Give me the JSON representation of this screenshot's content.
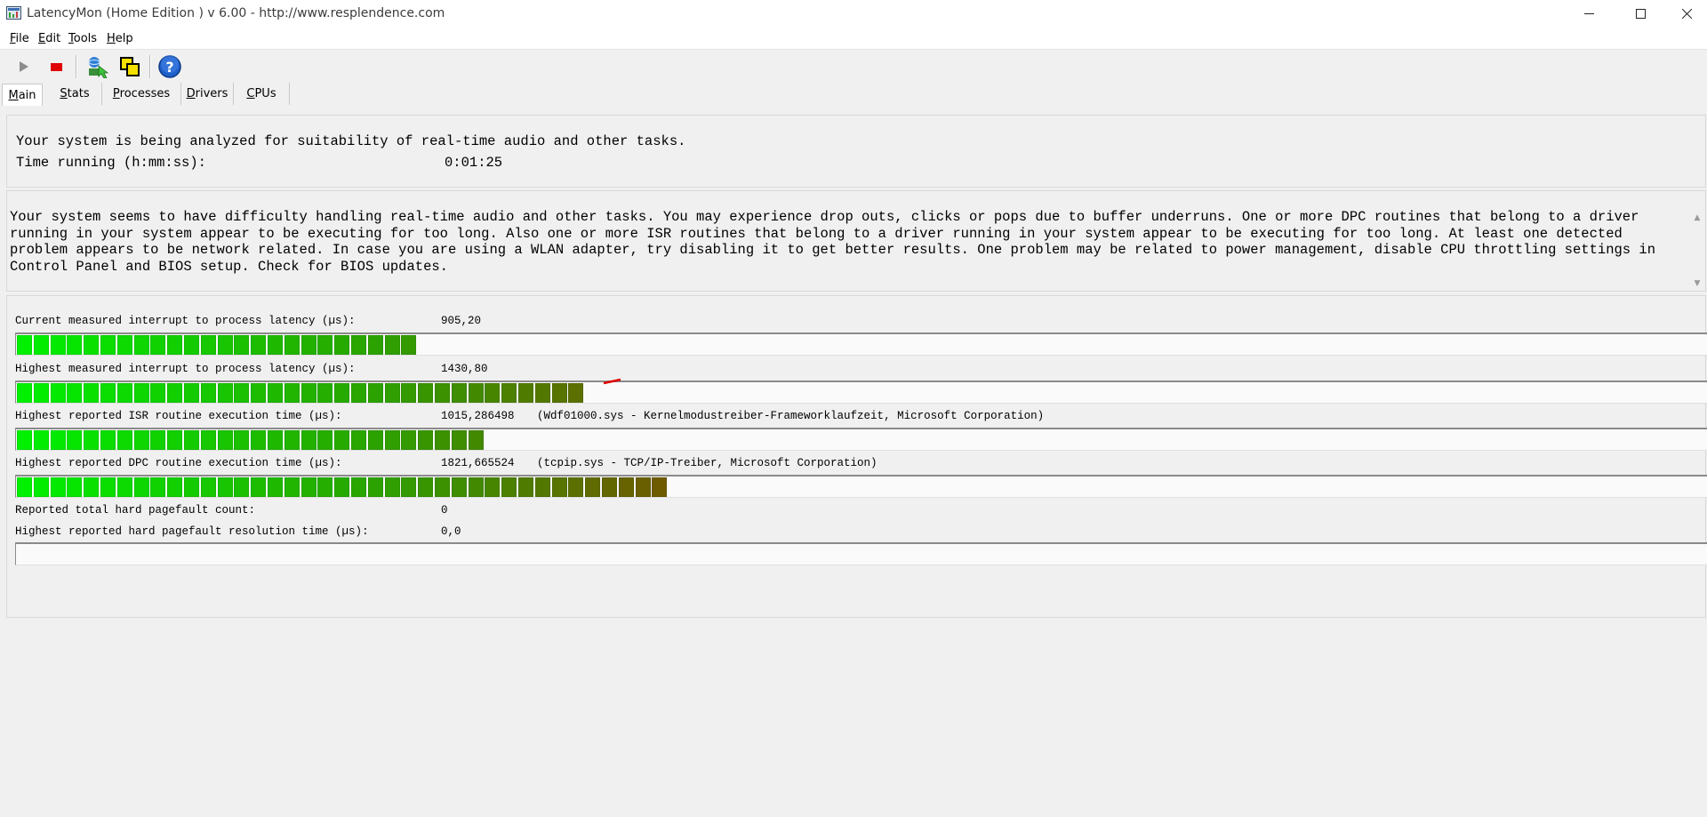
{
  "window": {
    "title": "LatencyMon  (Home Edition )  v 6.00 - http://www.resplendence.com",
    "icon": "latencymon-app-icon"
  },
  "menu": [
    {
      "label": "File",
      "accel": "F",
      "rest": "ile"
    },
    {
      "label": "Edit",
      "accel": "E",
      "rest": "dit"
    },
    {
      "label": "Tools",
      "accel": "T",
      "rest": "ools"
    },
    {
      "label": "Help",
      "accel": "H",
      "rest": "elp"
    }
  ],
  "toolbar": {
    "icons": [
      "play-icon",
      "stop-icon",
      "update-check-icon",
      "cpu-icon",
      "help-icon"
    ]
  },
  "tabs": [
    {
      "label": "Main",
      "accel": "M",
      "rest": "ain",
      "active": true
    },
    {
      "label": "Stats",
      "accel": "S",
      "rest": "tats"
    },
    {
      "label": "Processes",
      "accel": "P",
      "rest": "rocesses"
    },
    {
      "label": "Drivers",
      "accel": "D",
      "rest": "rivers"
    },
    {
      "label": "CPUs",
      "accel": "C",
      "rest": "PUs"
    }
  ],
  "status": {
    "line1": "Your system is being analyzed for suitability of real-time audio and other tasks.",
    "time_label": "Time running (h:mm:ss):",
    "time_value": "0:01:25"
  },
  "message": "Your system seems to have difficulty handling real-time audio and other tasks. You may experience drop outs, clicks or pops due to buffer underruns. One or more DPC routines that belong to a driver running in your system appear to be executing for too long. Also one or more ISR routines that belong to a driver running in your system appear to be executing for too long. At least one detected problem appears to be network related. In case you are using a WLAN adapter, try disabling it to get better results. One problem may be related to power management, disable CPU throttling settings in Control Panel and BIOS setup. Check for BIOS updates.",
  "metrics": [
    {
      "label": "Current measured interrupt to process latency (µs):",
      "value": "905,20",
      "detail": "",
      "level": 0.2375
    },
    {
      "label": "Highest measured interrupt to process latency (µs):",
      "value": "1430,80",
      "detail": "",
      "level": 0.3375
    },
    {
      "label": "Highest reported ISR routine execution time (µs):",
      "value": "1015,286498",
      "detail": "(Wdf01000.sys - Kernelmodustreiber-Frameworklaufzeit, Microsoft Corporation)",
      "level": 0.275
    },
    {
      "label": "Highest reported DPC routine execution time (µs):",
      "value": "1821,665524",
      "detail": "(tcpip.sys - TCP/IP-Treiber, Microsoft Corporation)",
      "level": 0.3825
    },
    {
      "label": "Reported total hard pagefault count:",
      "value": "0",
      "detail": ""
    },
    {
      "label": "Highest reported hard pagefault resolution time (µs):",
      "value": "0,0",
      "detail": "",
      "level": 0
    }
  ],
  "colors": {
    "gauge_start": "#00f000",
    "gauge_mid": "#2aa400",
    "gauge_end": "#7a4e00",
    "stop": "#e00000",
    "help": "#1f5fc8"
  }
}
